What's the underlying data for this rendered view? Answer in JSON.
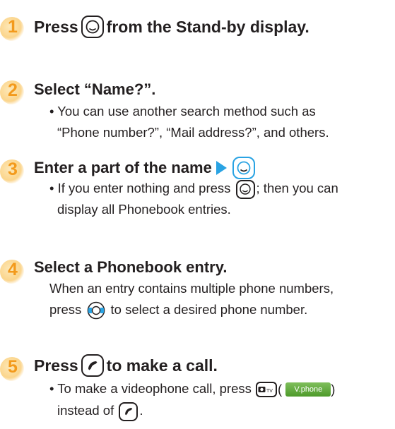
{
  "steps": [
    {
      "number": "1",
      "title_before": "Press",
      "title_after": "from the Stand-by display."
    },
    {
      "number": "2",
      "title": "Select “Name?”.",
      "bullet_line1": "• You can use another search method such as",
      "bullet_line2": "“Phone number?”, “Mail address?”, and others."
    },
    {
      "number": "3",
      "title": "Enter a part of the name",
      "bullet_before": "• If you enter nothing and press",
      "bullet_after": "; then you can",
      "bullet_line2": "display all Phonebook entries."
    },
    {
      "number": "4",
      "title": "Select a Phonebook entry.",
      "line1": "When an entry contains multiple phone numbers,",
      "line2_before": "press",
      "line2_after": "to select a desired phone number."
    },
    {
      "number": "5",
      "title_before": "Press",
      "title_after": "to make a call.",
      "bullet_before": "• To make a videophone call, press",
      "paren_open": "(",
      "vphone_label": "V.phone",
      "paren_close": ")",
      "line2_before": "instead of",
      "line2_after": "."
    }
  ],
  "icons": {
    "center_key": "center-select-key-icon",
    "multi_key": "multi-direction-key-icon",
    "call_key": "call-key-icon",
    "camera_tv_key": "camera-tv-key-icon",
    "arrow": "right-arrow-icon"
  },
  "colors": {
    "step_number": "#f39a1c",
    "arrow": "#29a3e3",
    "vphone_button": "#5aa535"
  }
}
